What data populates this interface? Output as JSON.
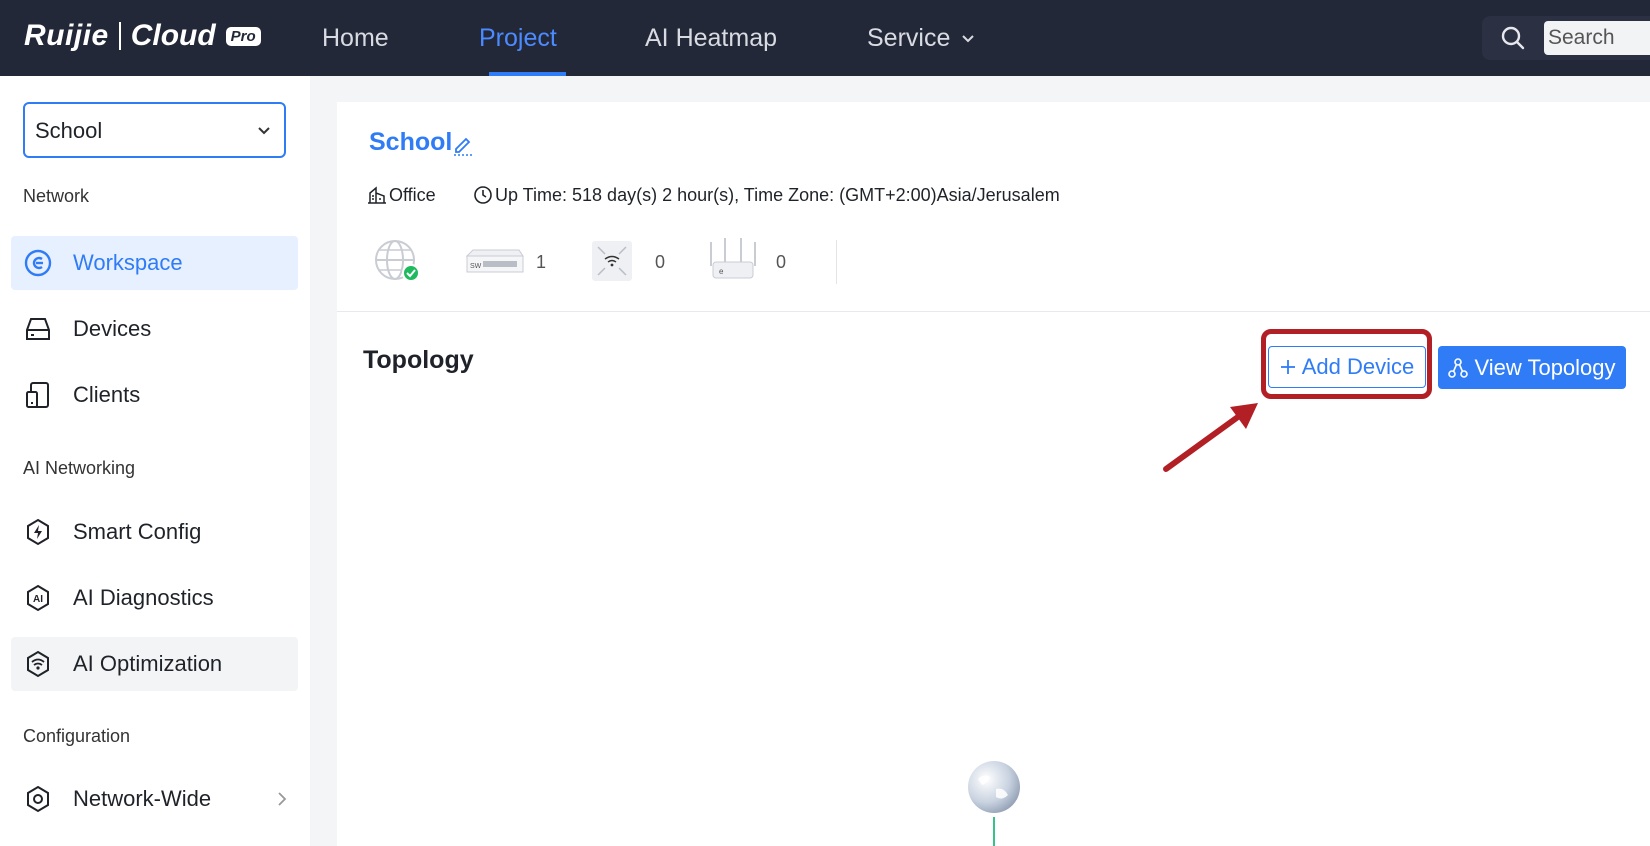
{
  "brand": {
    "name": "Ruijie",
    "product": "Cloud",
    "badge": "Pro"
  },
  "nav": {
    "items": [
      {
        "label": "Home",
        "active": false
      },
      {
        "label": "Project",
        "active": true
      },
      {
        "label": "AI Heatmap",
        "active": false
      },
      {
        "label": "Service",
        "active": false,
        "has_dropdown": true
      }
    ],
    "search_placeholder": "Search"
  },
  "sidebar": {
    "project_selector": "School",
    "sections": [
      {
        "title": "Network",
        "items": [
          {
            "label": "Workspace",
            "icon": "workspace-icon",
            "active": true
          },
          {
            "label": "Devices",
            "icon": "devices-icon",
            "active": false
          },
          {
            "label": "Clients",
            "icon": "clients-icon",
            "active": false
          }
        ]
      },
      {
        "title": "AI Networking",
        "items": [
          {
            "label": "Smart Config",
            "icon": "smart-config-icon",
            "active": false
          },
          {
            "label": "AI Diagnostics",
            "icon": "ai-diagnostics-icon",
            "active": false
          },
          {
            "label": "AI Optimization",
            "icon": "ai-optimization-icon",
            "active": false,
            "hovered": true
          }
        ]
      },
      {
        "title": "Configuration",
        "items": [
          {
            "label": "Network-Wide",
            "icon": "gear-icon",
            "active": false,
            "has_submenu": true
          }
        ]
      }
    ]
  },
  "site": {
    "title": "School",
    "scenario": "Office",
    "uptime_text": "Up Time: 518 day(s) 2 hour(s), Time Zone: (GMT+2:00)Asia/Jerusalem",
    "stats": [
      {
        "device": "gateway",
        "status": "online"
      },
      {
        "device": "switch",
        "count": "1"
      },
      {
        "device": "access-point",
        "count": "0"
      },
      {
        "device": "router",
        "count": "0"
      }
    ]
  },
  "topology": {
    "title": "Topology",
    "add_device_label": "Add Device",
    "view_topology_label": "View Topology"
  },
  "colors": {
    "nav_bg": "#232838",
    "accent": "#2f7cf6",
    "highlight": "#b21f24",
    "online": "#1fba5f"
  }
}
